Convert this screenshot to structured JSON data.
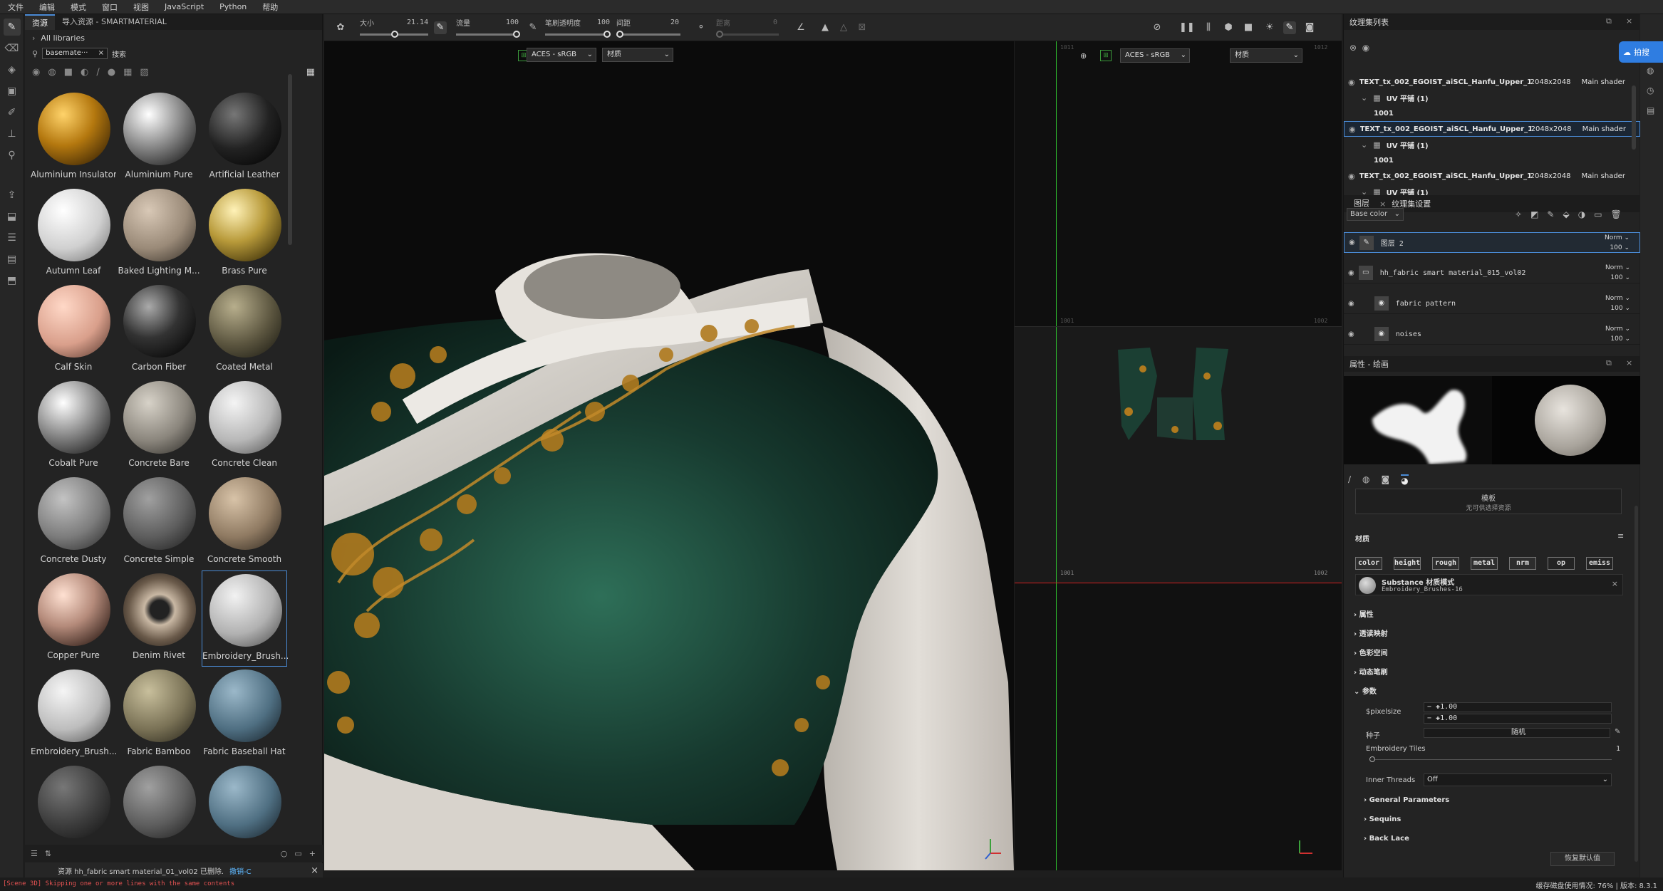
{
  "menu": [
    "文件",
    "编辑",
    "模式",
    "窗口",
    "视图",
    "JavaScript",
    "Python",
    "帮助"
  ],
  "shelf": {
    "tabs": [
      "资源",
      "导入资源 - SMARTMATERIAL"
    ],
    "libraries_label": "All libraries",
    "search_chip": "basemate···",
    "search_label": "搜索",
    "materials": [
      {
        "name": "Aluminium Insulator",
        "style": "gold-hex"
      },
      {
        "name": "Aluminium Pure",
        "style": "chrome"
      },
      {
        "name": "Artificial Leather",
        "style": "dark"
      },
      {
        "name": "Autumn Leaf",
        "style": "leaf"
      },
      {
        "name": "Baked Lighting M...",
        "style": "beige"
      },
      {
        "name": "Brass Pure",
        "style": "brass"
      },
      {
        "name": "Calf Skin",
        "style": "skin"
      },
      {
        "name": "Carbon Fiber",
        "style": "carbon"
      },
      {
        "name": "Coated Metal",
        "style": "olive"
      },
      {
        "name": "Cobalt Pure",
        "style": "chrome"
      },
      {
        "name": "Concrete Bare",
        "style": "concrete"
      },
      {
        "name": "Concrete Clean",
        "style": "lightgrey"
      },
      {
        "name": "Concrete Dusty",
        "style": "grey"
      },
      {
        "name": "Concrete Simple",
        "style": "midgrey"
      },
      {
        "name": "Concrete Smooth",
        "style": "tan"
      },
      {
        "name": "Copper Pure",
        "style": "copper"
      },
      {
        "name": "Denim Rivet",
        "style": "rivet"
      },
      {
        "name": "Embroidery_Brush...",
        "style": "emboss"
      },
      {
        "name": "Embroidery_Brush...",
        "style": "emboss2"
      },
      {
        "name": "Fabric Bamboo",
        "style": "bamboo"
      },
      {
        "name": "Fabric Baseball Hat",
        "style": "blue"
      },
      {
        "name": "",
        "style": "darkgrey"
      },
      {
        "name": "",
        "style": "midgrey"
      },
      {
        "name": "",
        "style": "blue"
      }
    ],
    "status_msg": "资源 hh_fabric smart material_01_vol02 已删除.",
    "status_link": "撤销-C"
  },
  "toolbar": {
    "size_label": "大小",
    "size_value": "21.14",
    "flow_label": "流量",
    "flow_value": "100",
    "stroke_opacity_label": "笔刷透明度",
    "stroke_opacity_value": "100",
    "spacing_label": "间距",
    "spacing_value": "20",
    "distance_label": "距离",
    "distance_value": "0"
  },
  "viewport": {
    "colorspace": "ACES - sRGB",
    "mode": "材质",
    "uv_colorspace": "ACES - sRGB",
    "uv_mode": "材质",
    "uv_labels": [
      "1011",
      "1012",
      "1001",
      "1002"
    ]
  },
  "texture_sets": {
    "title": "纹理集列表",
    "items": [
      {
        "name": "TEXT_tx_002_EGOIST_aiSCL_Hanfu_Upper_1...",
        "res": "2048x2048",
        "shader": "Main shader",
        "uv": "UV 平铺 (1)",
        "tile": "1001"
      },
      {
        "name": "TEXT_tx_002_EGOIST_aiSCL_Hanfu_Upper_1...",
        "res": "2048x2048",
        "shader": "Main shader",
        "uv": "UV 平铺 (1)",
        "tile": "1001"
      },
      {
        "name": "TEXT_tx_002_EGOIST_aiSCL_Hanfu_Upper_1...",
        "res": "2048x2048",
        "shader": "Main shader",
        "uv": "UV 平铺 (1)",
        "tile": ""
      }
    ]
  },
  "layers": {
    "tabs": [
      "图层",
      "纹理集设置"
    ],
    "channel": "Base color",
    "items": [
      {
        "name": "图层 2",
        "blend": "Norm",
        "opacity": "100"
      },
      {
        "name": "hh_fabric smart material_015_vol02",
        "blend": "Norm",
        "opacity": "100"
      },
      {
        "name": "fabric pattern",
        "blend": "Norm",
        "opacity": "100"
      },
      {
        "name": "noises",
        "blend": "Norm",
        "opacity": "100"
      }
    ]
  },
  "properties": {
    "title": "属性 - 绘画",
    "template_label": "模板",
    "template_value": "无可供选择资源",
    "material_label": "材质",
    "channels": [
      "color",
      "height",
      "rough",
      "metal",
      "nrm",
      "op",
      "emiss"
    ],
    "substance_title": "Substance 材质模式",
    "substance_name": "Embroidery_Brushes-16",
    "sections": [
      "属性",
      "透读映射",
      "色彩空间",
      "动态笔刷",
      "参数"
    ],
    "pixelsize_label": "$pixelsize",
    "pixelsize_1": "1.00",
    "pixelsize_2": "1.00",
    "seed_label": "种子",
    "seed_value": "随机",
    "tiles_label": "Embroidery Tiles",
    "tiles_value": "1",
    "inner_label": "Inner Threads",
    "inner_value": "Off",
    "groups": [
      "General Parameters",
      "Sequins",
      "Back Lace"
    ],
    "reset_label": "恢复默认值"
  },
  "right_strip_label": "拍搜",
  "statusbar": {
    "text": "缓存磁盘使用情况: 76% | 版本: 8.3.1"
  },
  "log": "[Scene 3D] Skipping one or more lines with the same contents",
  "colors": {
    "accent": "#4a8bd6",
    "uv_green": "#2fbf2f",
    "uv_red": "#d42020",
    "garment_green": "#1c4a3a",
    "gold": "#b07a1e",
    "cloth_white": "#d9d5cf"
  }
}
